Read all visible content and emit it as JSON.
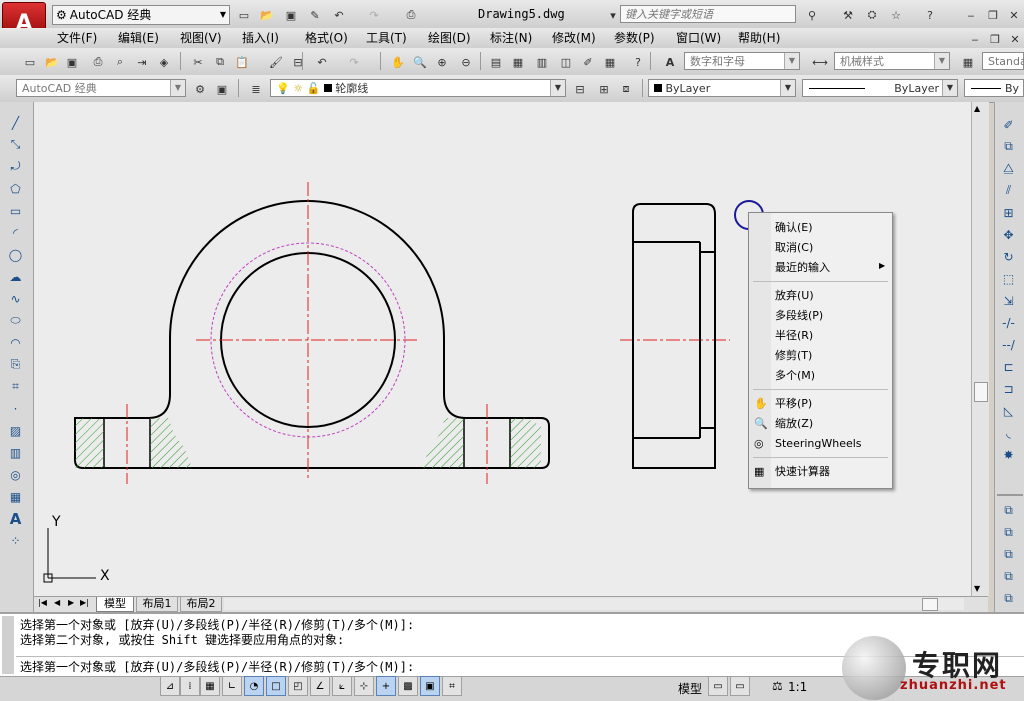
{
  "title_bar": {
    "workspace": "AutoCAD 经典",
    "document": "Drawing5.dwg",
    "search_placeholder": "键入关键字或短语"
  },
  "menu": [
    "文件(F)",
    "编辑(E)",
    "视图(V)",
    "插入(I)",
    "格式(O)",
    "工具(T)",
    "绘图(D)",
    "标注(N)",
    "修改(M)",
    "参数(P)",
    "窗口(W)",
    "帮助(H)"
  ],
  "toolbar": {
    "text_style": "数字和字母",
    "dim_style": "机械样式",
    "table_style": "Standa",
    "workspace_combo": "AutoCAD 经典",
    "layer": "轮廓线",
    "color": "ByLayer",
    "linetype": "ByLayer",
    "lineweight": "By"
  },
  "context_menu": {
    "items_top": [
      "确认(E)",
      "取消(C)",
      "最近的输入"
    ],
    "items_mid": [
      "放弃(U)",
      "多段线(P)",
      "半径(R)",
      "修剪(T)",
      "多个(M)"
    ],
    "items_nav": [
      "平移(P)",
      "缩放(Z)",
      "SteeringWheels"
    ],
    "items_bottom": [
      "快速计算器"
    ]
  },
  "ucs": {
    "x": "X",
    "y": "Y"
  },
  "tabs": [
    "模型",
    "布局1",
    "布局2"
  ],
  "command": {
    "history_1": "选择第一个对象或 [放弃(U)/多段线(P)/半径(R)/修剪(T)/多个(M)]:",
    "history_2": "选择第二个对象, 或按住 Shift 键选择要应用角点的对象:",
    "prompt": "选择第一个对象或 [放弃(U)/多段线(P)/半径(R)/修剪(T)/多个(M)]:"
  },
  "status": {
    "space": "模型",
    "scale": "1:1"
  },
  "watermark": {
    "cn": "专职网",
    "url": "zhuanzhi.net"
  },
  "colors": {
    "canvas": "#ececec",
    "center_line": "#e0201e",
    "hidden_circle": "#c040c0",
    "hatch": "#2f9a2f",
    "cursor": "#1a1a9a"
  }
}
